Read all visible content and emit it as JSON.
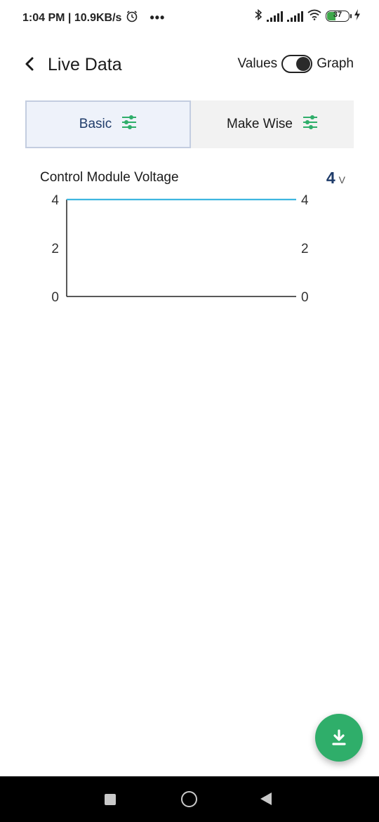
{
  "status_bar": {
    "time_speed": "1:04 PM | 10.9KB/s",
    "more": "•••",
    "battery_level": "37",
    "icons": [
      "alarm-icon",
      "bluetooth-icon",
      "signal-icon",
      "signal-icon",
      "wifi-icon",
      "battery-icon",
      "charging-icon"
    ]
  },
  "header": {
    "title": "Live Data",
    "toggle_left_label": "Values",
    "toggle_right_label": "Graph"
  },
  "tabs": [
    {
      "label": "Basic",
      "active": true,
      "icon": "filter-sliders-icon"
    },
    {
      "label": "Make Wise",
      "active": false,
      "icon": "filter-sliders-icon"
    }
  ],
  "metric": {
    "label": "Control Module Voltage",
    "value": "4",
    "unit": "V"
  },
  "colors": {
    "accent": "#1f3c6a",
    "line": "#3fb6e0",
    "fab": "#2fae6a",
    "slider_icon": "#2fae6a"
  },
  "chart_data": {
    "type": "line",
    "y_ticks_left": [
      "4",
      "2",
      "0"
    ],
    "y_ticks_right": [
      "4",
      "2",
      "0"
    ],
    "ylim": [
      0,
      4
    ],
    "series": [
      {
        "values": [
          4,
          4
        ]
      }
    ],
    "grid": false
  },
  "fab": {
    "icon": "download-icon"
  },
  "nav_bar": {
    "icons": [
      "recents-square-icon",
      "home-circle-icon",
      "back-triangle-icon"
    ]
  }
}
